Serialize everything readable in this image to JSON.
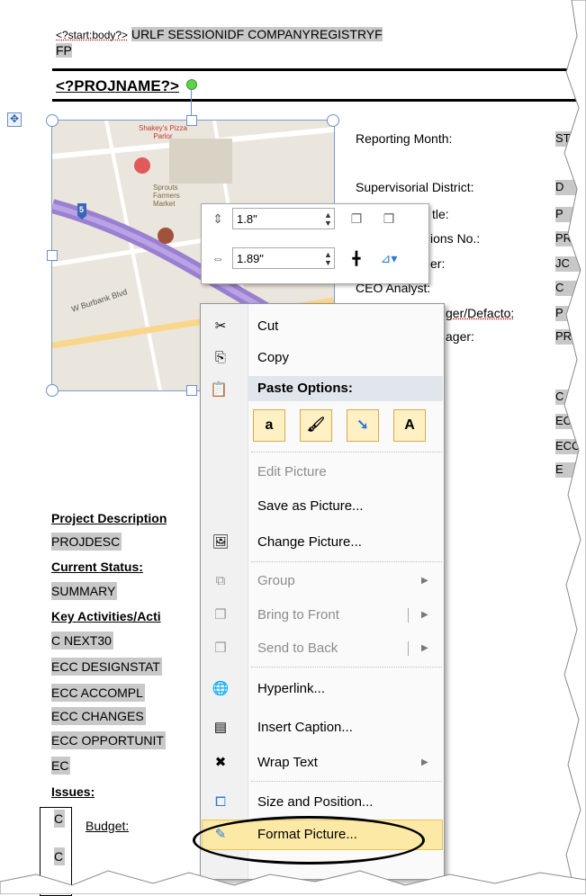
{
  "header": {
    "start_tag": "<?start:body?>",
    "fields_line1": "URLF SESSIONIDF COMPANYREGISTRYF",
    "fields_line2": "FP",
    "projname": "<?PROJNAME?>"
  },
  "right_panel": {
    "reporting_month_label": "Reporting Month:",
    "reporting_month_value": "ST",
    "supervisorial_district_label": "Supervisorial District:",
    "supervisorial_district_value": "D",
    "project_title_label": "tle:",
    "project_title_value": "P",
    "specifications_label": "ions No.:",
    "specifications_value": "PR",
    "manager_label": "er:",
    "manager_value": "JC",
    "ceo_analyst_label": "CEO Analyst:",
    "ceo_analyst_value": "C",
    "project_manager_label": "ger/Defacto:",
    "project_manager_value": "P",
    "manager2_label": "ager:",
    "manager2_value": "PR",
    "extra_values": [
      "C A",
      "ECC",
      "ECC",
      "E"
    ]
  },
  "picture": {
    "map_labels": [
      "Shakey's Pizza Parlor",
      "Sprouts Farmers Market",
      "W Burbank Blvd",
      "5"
    ]
  },
  "size_toolbar": {
    "height_value": "1.8\"",
    "width_value": "1.89\""
  },
  "left_column": {
    "project_description": "Project Description",
    "projdesc": "PROJDESC",
    "current_status": "Current Status:",
    "summary": "SUMMARY",
    "key_activities": "Key Activities/Acti",
    "c_next30": "C NEXT30",
    "ecc_designstat": "ECC DESIGNSTAT",
    "ecc_accompl": "ECC ACCOMPL",
    "ecc_changes": "ECC CHANGES",
    "ecc_opportunit": "ECC OPPORTUNIT",
    "ec": "EC",
    "issues": "Issues:",
    "c1": "C",
    "budget": "Budget:",
    "c2": "C"
  },
  "context_menu": {
    "cut": "Cut",
    "copy": "Copy",
    "paste_options": "Paste Options:",
    "paste_buttons": [
      "a",
      "",
      "",
      "A"
    ],
    "edit_picture": "Edit Picture",
    "save_as_picture": "Save as Picture...",
    "change_picture": "Change Picture...",
    "group": "Group",
    "bring_to_front": "Bring to Front",
    "send_to_back": "Send to Back",
    "hyperlink": "Hyperlink...",
    "insert_caption": "Insert Caption...",
    "wrap_text": "Wrap Text",
    "size_and_position": "Size and Position...",
    "format_picture": "Format Picture..."
  }
}
